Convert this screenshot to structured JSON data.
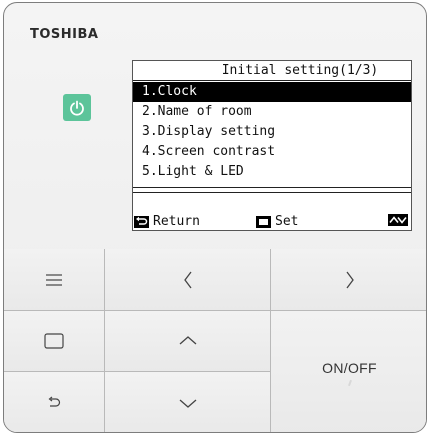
{
  "brand": "TOSHIBA",
  "screen": {
    "title": "Initial setting(1/3)",
    "items": [
      {
        "label": "1.Clock",
        "selected": true
      },
      {
        "label": "2.Name of room",
        "selected": false
      },
      {
        "label": "3.Display setting",
        "selected": false
      },
      {
        "label": "4.Screen contrast",
        "selected": false
      },
      {
        "label": "5.Light & LED",
        "selected": false
      }
    ],
    "footer": {
      "return_label": "Return",
      "set_label": "Set"
    }
  },
  "buttons": {
    "on_off_label": "ON/OFF"
  },
  "colors": {
    "power_led": "#5cc49a",
    "lcd_background": "#ffffff",
    "selection": "#000000"
  },
  "icons": [
    "power-icon",
    "menu-icon",
    "left-arrow-icon",
    "right-arrow-icon",
    "square-icon",
    "up-arrow-icon",
    "down-arrow-icon",
    "return-icon",
    "up-down-icon"
  ]
}
